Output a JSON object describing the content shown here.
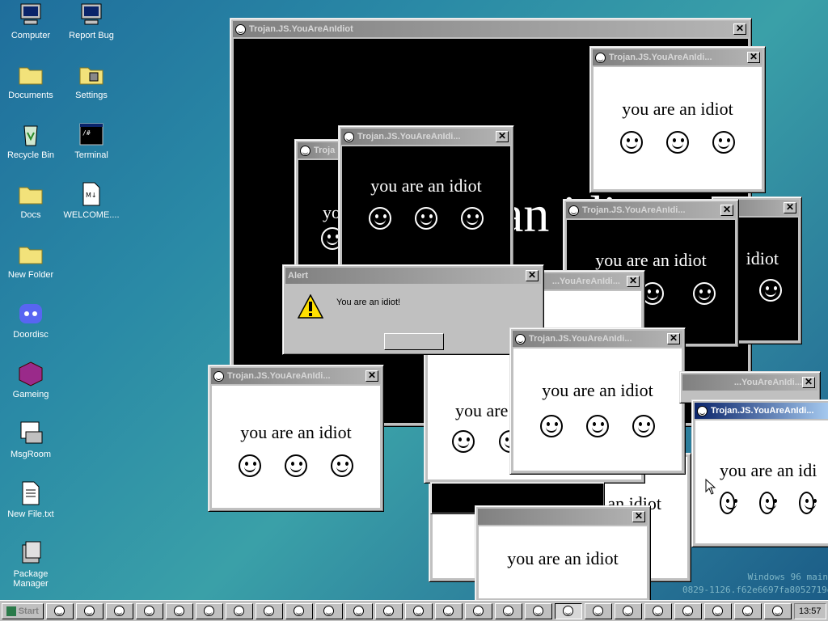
{
  "desktop": {
    "icons": [
      {
        "label": "Computer",
        "icon": "computer-icon"
      },
      {
        "label": "Report Bug",
        "icon": "computer-icon"
      },
      {
        "label": "Documents",
        "icon": "folder-icon"
      },
      {
        "label": "Settings",
        "icon": "settings-icon"
      },
      {
        "label": "Recycle Bin",
        "icon": "recycle-bin-icon"
      },
      {
        "label": "Terminal",
        "icon": "terminal-icon"
      },
      {
        "label": "Docs",
        "icon": "folder-icon"
      },
      {
        "label": "WELCOME....",
        "icon": "markdown-file-icon"
      },
      {
        "label": "New Folder",
        "icon": "folder-icon"
      },
      {
        "label": "Doordisc",
        "icon": "doordisc-icon"
      },
      {
        "label": "Gameing",
        "icon": "cube-icon"
      },
      {
        "label": "MsgRoom",
        "icon": "msgroom-icon"
      },
      {
        "label": "New File.txt",
        "icon": "text-file-icon"
      },
      {
        "label": "Package Manager",
        "icon": "package-manager-icon"
      }
    ]
  },
  "watermark": {
    "line1": "Windows 96 main",
    "line2": "0829-1126.f62e6697fa8052719e13"
  },
  "windows": {
    "big": {
      "title": "Trojan.JS.YouAreAnIdiot",
      "message": "an idiot"
    },
    "w1": {
      "title": "Trojan.JS.YouAreAnIdi...",
      "message": "you are an idiot"
    },
    "w2": {
      "title": "Troja",
      "message": "yo"
    },
    "w3": {
      "title": "Trojan.JS.YouAreAnIdi...",
      "message": "you are an idiot"
    },
    "w4": {
      "title": "Trojan.JS.YouAreAnIdi...",
      "message": "you are an idiot"
    },
    "w5": {
      "title": "",
      "message": "idiot"
    },
    "w6": {
      "title": "Trojan.JS.YouAreAnIdi...",
      "message": "you are an idiot"
    },
    "w7": {
      "title": "...eAnIdi...",
      "message": "you are"
    },
    "w8": {
      "title": "Trojan.JS.YouAreAnIdi...",
      "message": "you are an idiot"
    },
    "w9": {
      "title": "...YouAreAnIdi...",
      "message": ""
    },
    "w10": {
      "title": "Trojan.JS.YouAreAnIdi...",
      "message": "you are an idi"
    },
    "w11": {
      "title": "",
      "message": "an idiot"
    },
    "w12": {
      "title": "",
      "message": "you are an idiot"
    }
  },
  "alert": {
    "title": "Alert",
    "message": "You are an idiot!",
    "ok_label": ""
  },
  "taskbar": {
    "start_label": "Start",
    "clock": "13:57",
    "button_count": 25
  }
}
